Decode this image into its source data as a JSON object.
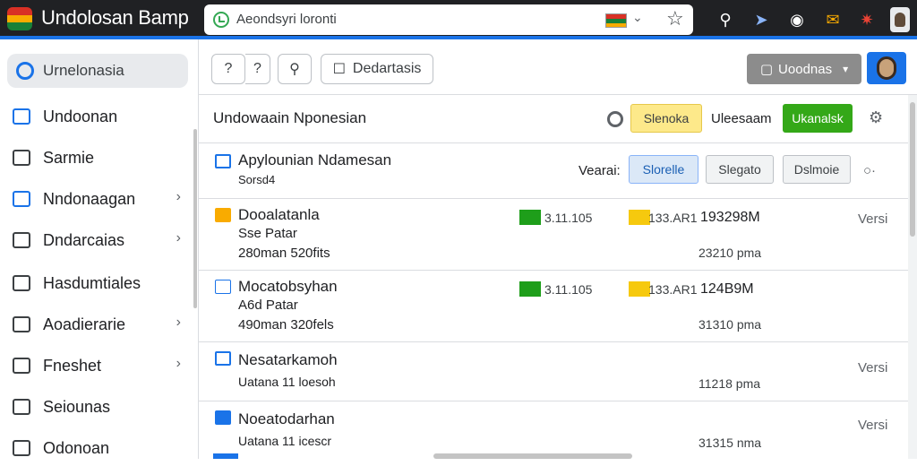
{
  "app": {
    "title": "Undolosan Bamp"
  },
  "omnibox": {
    "url": "Aeondsyri loronti"
  },
  "extensions": [
    "pin-icon",
    "arrow-icon",
    "chat-icon",
    "mail-icon",
    "puzzle-icon",
    "profile-icon"
  ],
  "sidebar": {
    "current": "Urnelonasia",
    "items": [
      {
        "label": "Undoonan",
        "icon": "list-icon",
        "chevron": false
      },
      {
        "label": "Sarmie",
        "icon": "file-icon",
        "chevron": false
      },
      {
        "label": "Nndonaagan",
        "icon": "folder-icon",
        "chevron": true
      },
      {
        "label": "Dndarcaias",
        "icon": "photo-icon",
        "chevron": true
      },
      {
        "label": "Hasdumtiales",
        "icon": "book-icon",
        "chevron": false
      },
      {
        "label": "Aoadierarie",
        "icon": "doc-icon",
        "chevron": true
      },
      {
        "label": "Fneshet",
        "icon": "home-icon",
        "chevron": true
      },
      {
        "label": "Seiounas",
        "icon": "menu-icon",
        "chevron": false
      },
      {
        "label": "Odonoan",
        "icon": "pill-icon",
        "chevron": false
      }
    ]
  },
  "toolbar": {
    "btn1": "?",
    "btn2": "?",
    "tag_label": "Dedartasis",
    "share_label": "Uoodnas"
  },
  "header": {
    "title": "Undowaain Nponesian",
    "yellow_label": "Slenoka",
    "text_label": "Uleesaam",
    "green_label": "Ukanalsk"
  },
  "subheader": {
    "title": "Apylounian Ndamesan",
    "sub": "Sorsd4",
    "view_label": "Vearai:",
    "opt_selected": "Slorelle",
    "opt2": "Slegato",
    "opt3": "Dslmoie"
  },
  "rows": [
    {
      "title": "Dooalatanla",
      "sub1": "Sse Patar",
      "sub2": "280man 520fits",
      "n1": "3.11.105",
      "n2": "133.AR1",
      "n3": "193298M",
      "n4": "23210 pma",
      "versi": "Versi"
    },
    {
      "title": "Mocatobsyhan",
      "sub1": "A6d Patar",
      "sub2": "490man 320fels",
      "n1": "3.11.105",
      "n2": "133.AR1",
      "n3": "124B9M",
      "n4": "31310 pma",
      "versi": "Versi"
    },
    {
      "title": "Nesatarkamoh",
      "sub1": "Uatana 11 loesoh",
      "n4": "11218 pma",
      "versi": "Versi"
    },
    {
      "title": "Noeatodarhan",
      "sub1": "Uatana 11 icescr",
      "n4": "31315 nma",
      "versi": "Versi"
    }
  ],
  "colors": {
    "accent": "#1a73e8",
    "green": "#34a818",
    "yellow": "#fde98a",
    "chrome": "#202124"
  }
}
